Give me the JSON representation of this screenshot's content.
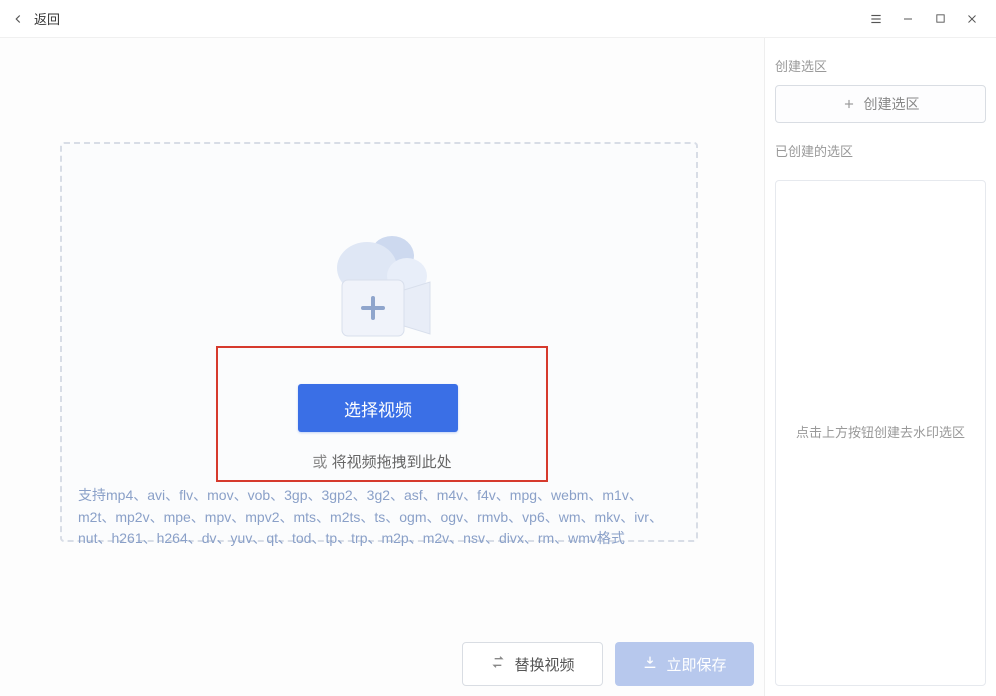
{
  "titlebar": {
    "back_label": "返回"
  },
  "main": {
    "select_video": "选择视频",
    "or": "或",
    "drag_hint": "将视频拖拽到此处",
    "formats": "支持mp4、avi、flv、mov、vob、3gp、3gp2、3g2、asf、m4v、f4v、mpg、webm、m1v、m2t、mp2v、mpe、mpv、mpv2、mts、m2ts、ts、ogm、ogv、rmvb、vp6、wm、mkv、ivr、nut、h261、h264、dv、yuv、qt、tod、tp、trp、m2p、m2v、nsv、divx、rm、wmv格式"
  },
  "sidebar": {
    "create_section": "创建选区",
    "create_btn": "创建选区",
    "created_section": "已创建的选区",
    "empty_hint": "点击上方按钮创建去水印选区"
  },
  "footer": {
    "replace": "替换视频",
    "save": "立即保存"
  }
}
